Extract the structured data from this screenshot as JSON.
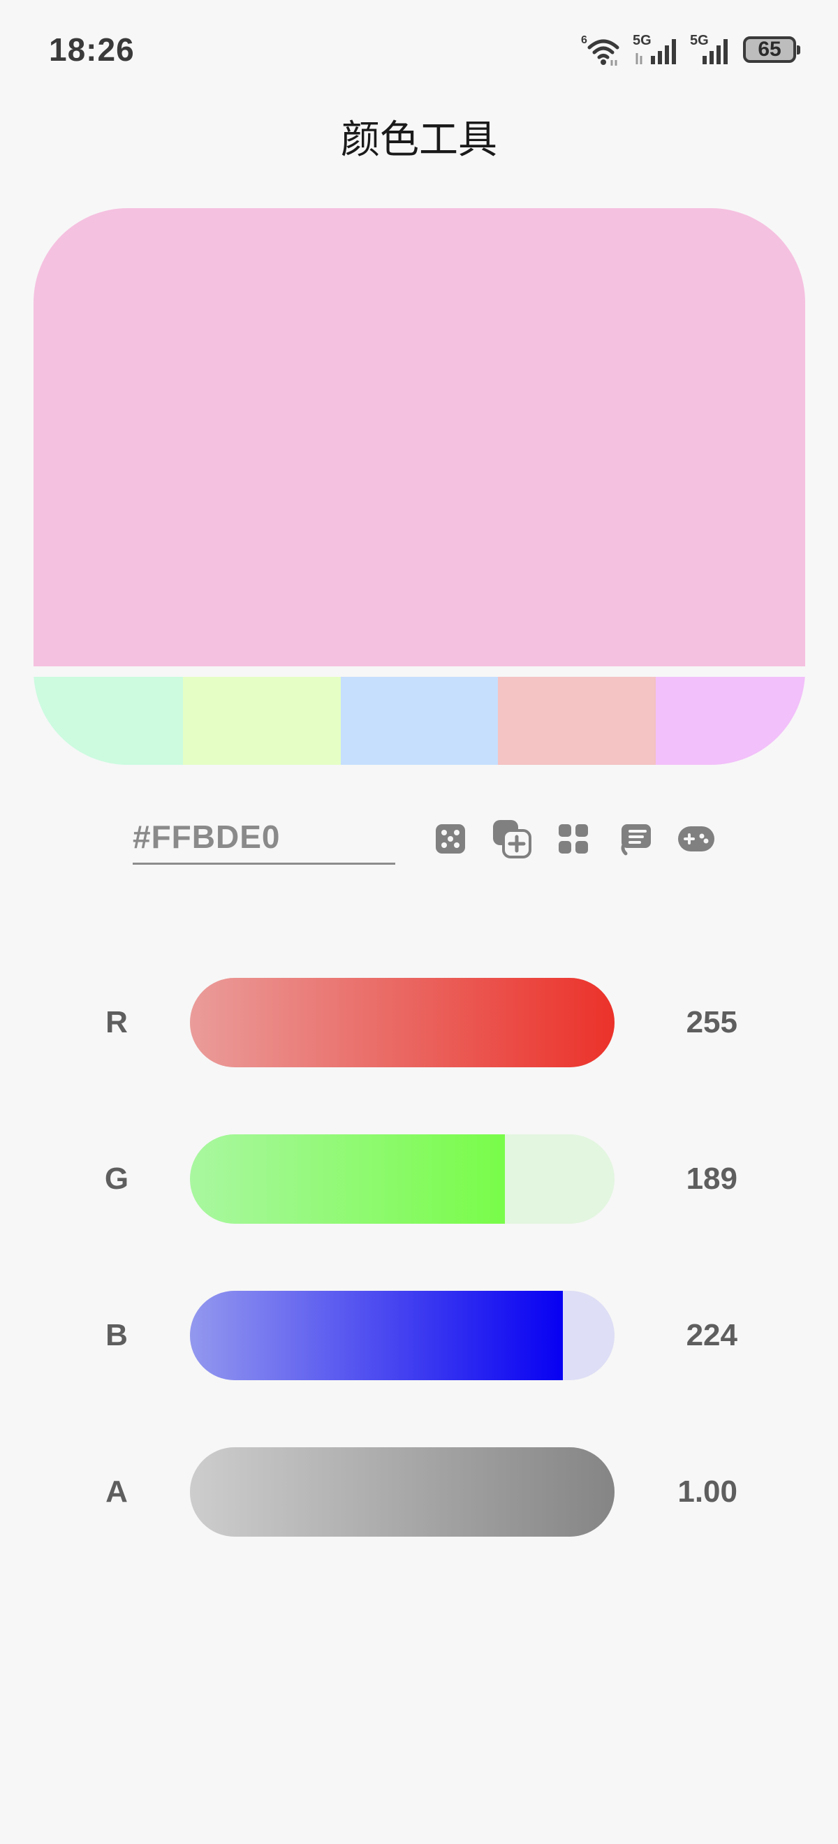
{
  "status_bar": {
    "time": "18:26",
    "wifi_label": "6",
    "signal1_label": "5G",
    "signal2_label": "5G",
    "battery": "65"
  },
  "title": "颜色工具",
  "preview": {
    "main_color": "#F5C1E0",
    "palette": [
      "#CCFBE0",
      "#E5FEC5",
      "#C6DFFD",
      "#F4C3C3",
      "#F2C0FA"
    ]
  },
  "hex": {
    "value": "#FFBDE0"
  },
  "tools": [
    "dice-icon",
    "add-copy-icon",
    "grid-icon",
    "sort-icon",
    "gamepad-icon"
  ],
  "channels": [
    {
      "label": "R",
      "value": "255",
      "fraction": 1.0,
      "colors": [
        "#EA9C9A",
        "#EB322A"
      ],
      "track_bg": "#F4D5D4"
    },
    {
      "label": "G",
      "value": "189",
      "fraction": 0.741,
      "colors": [
        "#A9F7A0",
        "#79FC49"
      ],
      "track_bg": "#E3F6E0"
    },
    {
      "label": "B",
      "value": "224",
      "fraction": 0.878,
      "colors": [
        "#9398EE",
        "#0700F2"
      ],
      "track_bg": "#DEDEF6"
    },
    {
      "label": "A",
      "value": "1.00",
      "fraction": 1.0,
      "colors": [
        "#CDCDCD",
        "#858585"
      ],
      "track_bg": "#E0E0E0"
    }
  ]
}
